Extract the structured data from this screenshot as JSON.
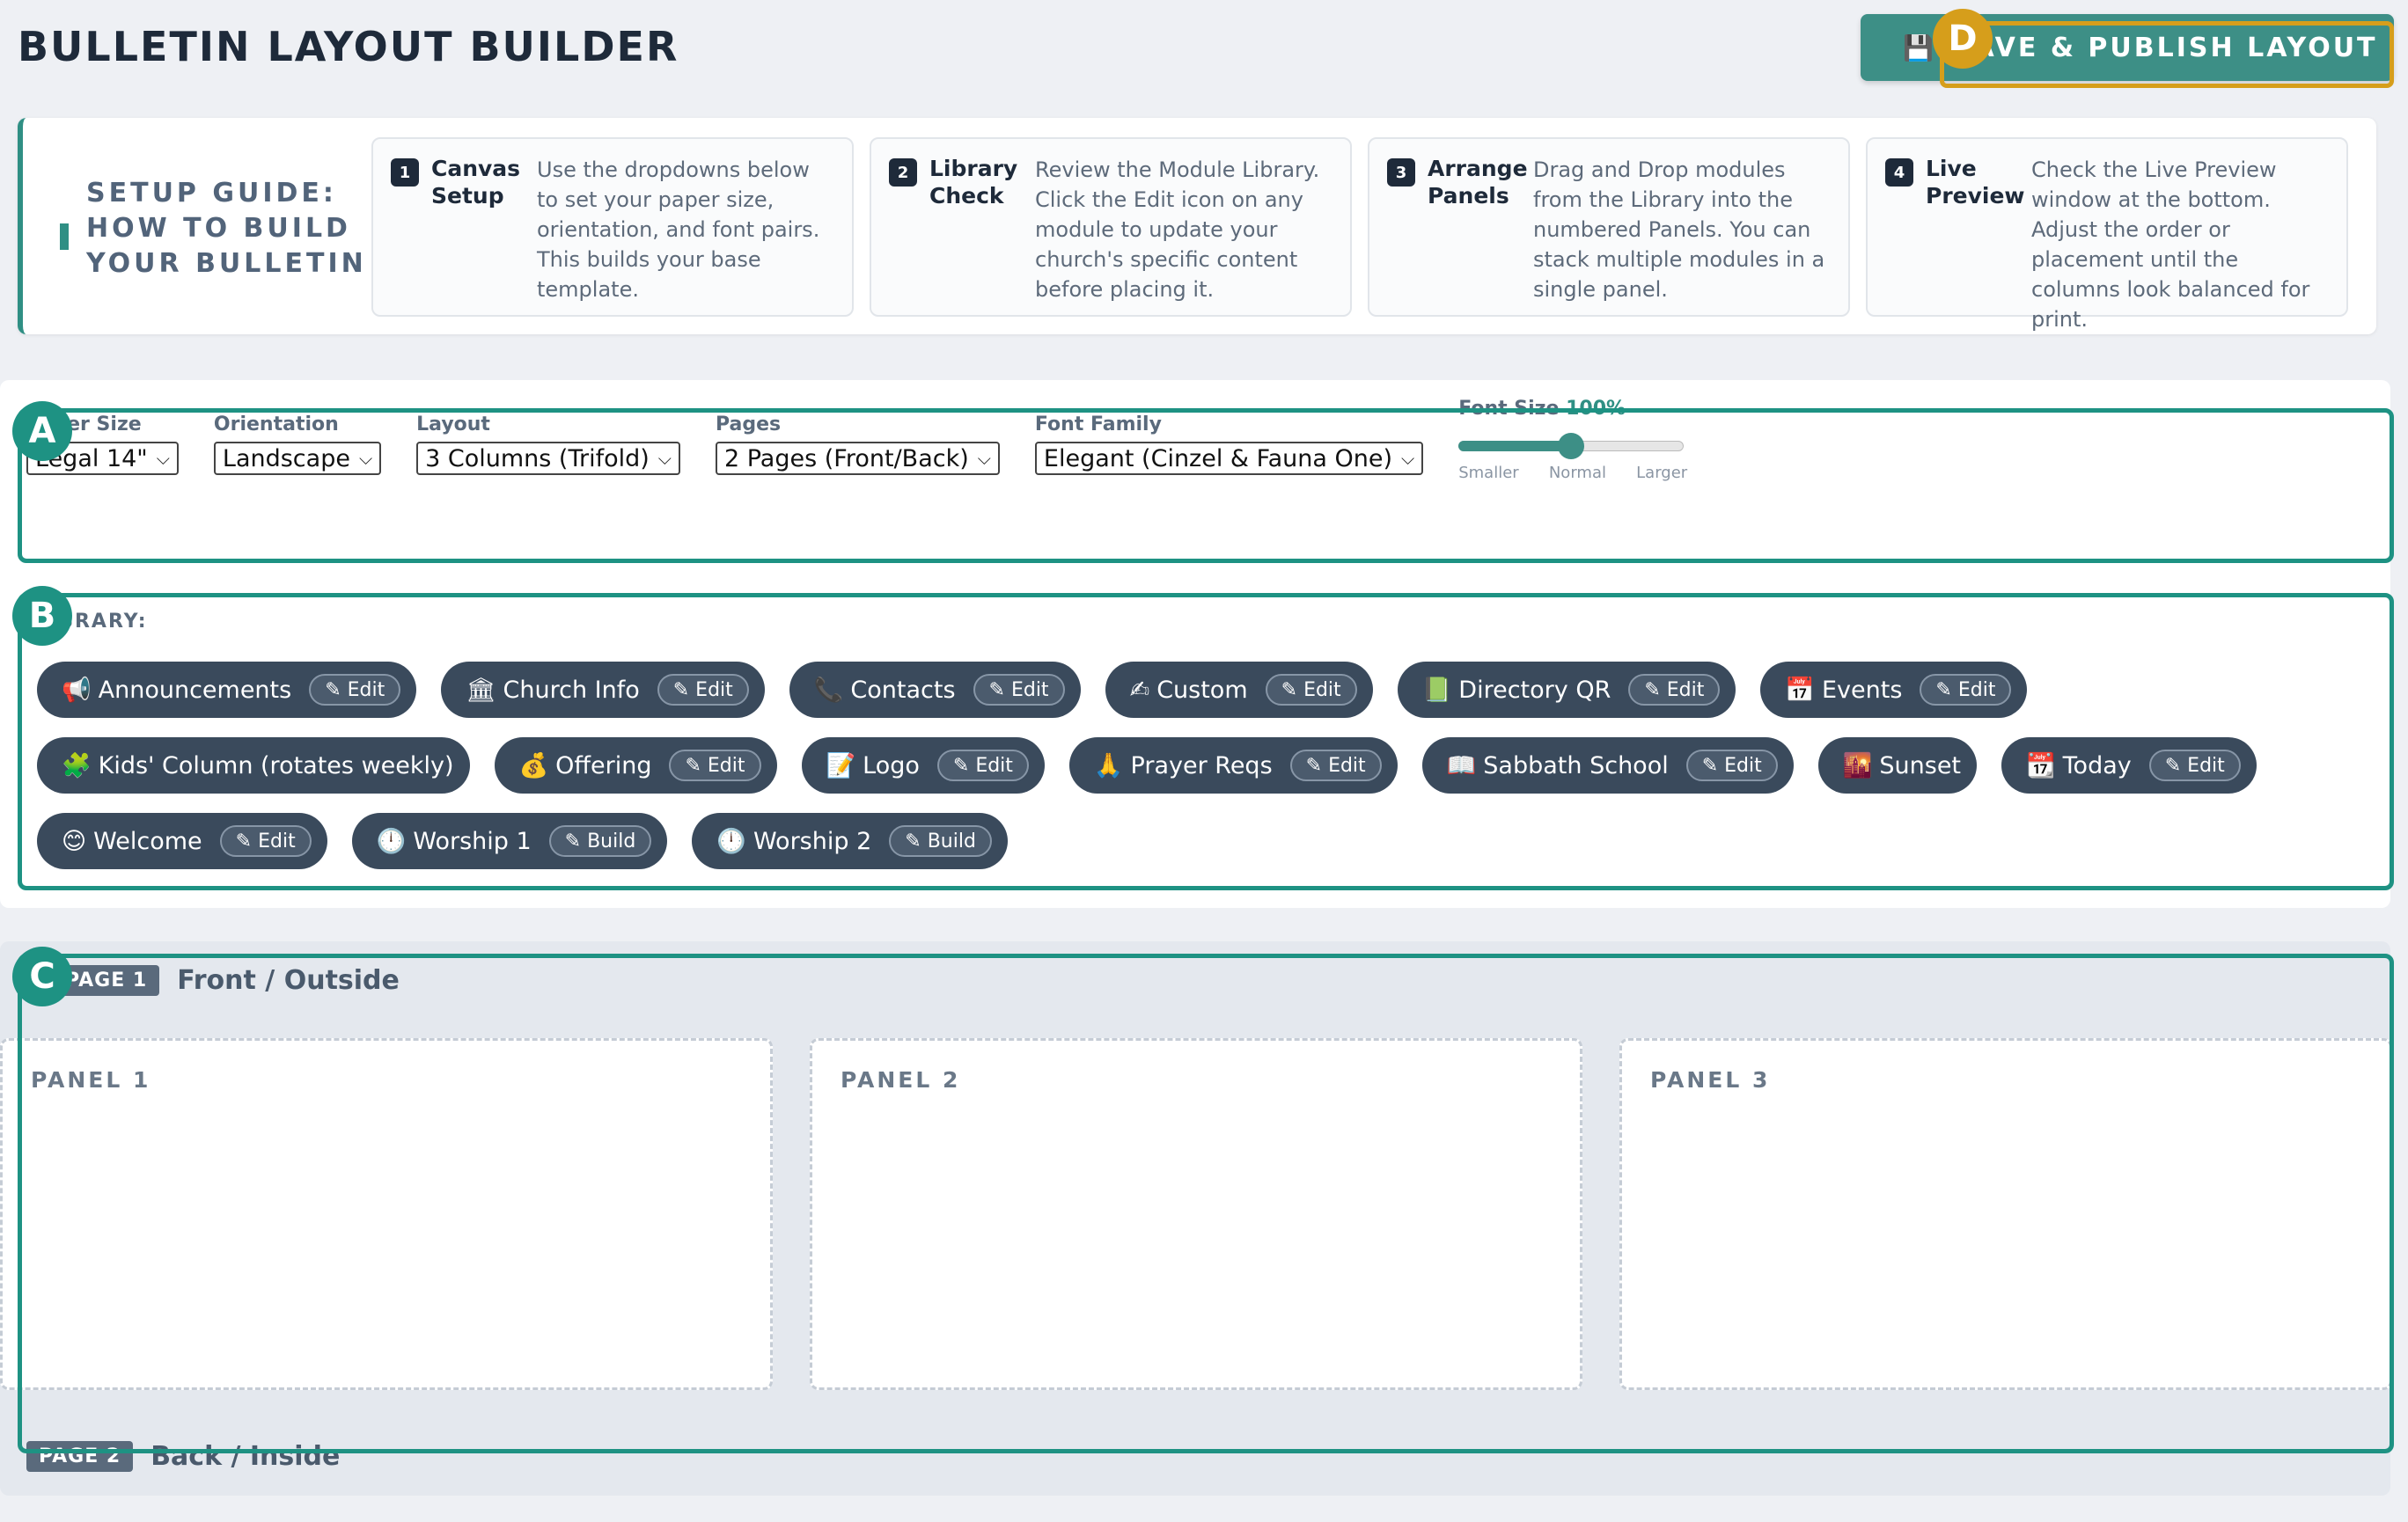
{
  "header": {
    "title": "BULLETIN LAYOUT BUILDER",
    "publish_icon": "💾",
    "publish_label": "SAVE & PUBLISH LAYOUT"
  },
  "guide": {
    "title_line1": "SETUP GUIDE:",
    "title_line2": "HOW TO BUILD",
    "title_line3": "YOUR BULLETIN",
    "steps": [
      {
        "num": "1",
        "name": "Canvas Setup",
        "desc": "Use the dropdowns below to set your paper size, orientation, and font pairs. This builds your base template."
      },
      {
        "num": "2",
        "name": "Library Check",
        "desc": "Review the Module Library. Click the Edit icon on any module to update your church's specific content before placing it."
      },
      {
        "num": "3",
        "name": "Arrange Panels",
        "desc": "Drag and Drop modules from the Library into the numbered Panels. You can stack multiple modules in a single panel."
      },
      {
        "num": "4",
        "name": "Live Preview",
        "desc": "Check the Live Preview window at the bottom. Adjust the order or placement until the columns look balanced for print."
      }
    ]
  },
  "controls": {
    "paper_size": {
      "label": "Paper Size",
      "value": "Legal 14\""
    },
    "orientation": {
      "label": "Orientation",
      "value": "Landscape"
    },
    "layout": {
      "label": "Layout",
      "value": "3 Columns (Trifold)"
    },
    "pages": {
      "label": "Pages",
      "value": "2 Pages (Front/Back)"
    },
    "font_family": {
      "label": "Font Family",
      "value": "Elegant (Cinzel & Fauna One)"
    },
    "font_size": {
      "label": "Font Size",
      "value": "100%",
      "level": 0.5,
      "ticks": [
        "Smaller",
        "Normal",
        "Larger"
      ]
    }
  },
  "library": {
    "label": "LIBRARY:",
    "row1": [
      {
        "icon": "📢",
        "name": "Announcements",
        "btn": "✎ Edit"
      },
      {
        "icon": "🏛",
        "name": "Church Info",
        "btn": "✎ Edit"
      },
      {
        "icon": "📞",
        "name": "Contacts",
        "btn": "✎ Edit"
      },
      {
        "icon": "✍",
        "name": "Custom",
        "btn": "✎ Edit"
      },
      {
        "icon": "📗",
        "name": "Directory QR",
        "btn": "✎ Edit"
      },
      {
        "icon": "📅",
        "name": "Events",
        "btn": "✎ Edit"
      }
    ],
    "row2": [
      {
        "icon": "🧩",
        "name": "Kids' Column (rotates weekly)",
        "btn": ""
      },
      {
        "icon": "💰",
        "name": "Offering",
        "btn": "✎ Edit"
      },
      {
        "icon": "📝",
        "name": "Logo",
        "btn": "✎ Edit"
      },
      {
        "icon": "🙏",
        "name": "Prayer Reqs",
        "btn": "✎ Edit"
      },
      {
        "icon": "📖",
        "name": "Sabbath School",
        "btn": "✎ Edit"
      },
      {
        "icon": "🌇",
        "name": "Sunset",
        "btn": ""
      },
      {
        "icon": "📆",
        "name": "Today",
        "btn": "✎ Edit"
      }
    ],
    "row3": [
      {
        "icon": "😊",
        "name": "Welcome",
        "btn": "✎ Edit"
      },
      {
        "icon": "🕛",
        "name": "Worship 1",
        "btn": "✎ Build"
      },
      {
        "icon": "🕛",
        "name": "Worship 2",
        "btn": "✎ Build"
      }
    ]
  },
  "pages": {
    "page1": {
      "tag": "PAGE 1",
      "name": "Front / Outside",
      "panels": [
        "PANEL 1",
        "PANEL 2",
        "PANEL 3"
      ]
    },
    "page2": {
      "tag": "PAGE 2",
      "name": "Back / Inside"
    }
  },
  "annotations": {
    "a": "A",
    "b": "B",
    "c": "C",
    "d": "D"
  },
  "colors": {
    "accent": "#1e9283",
    "highlight": "#d69e1b",
    "chip_bg": "#3a4a5c"
  }
}
